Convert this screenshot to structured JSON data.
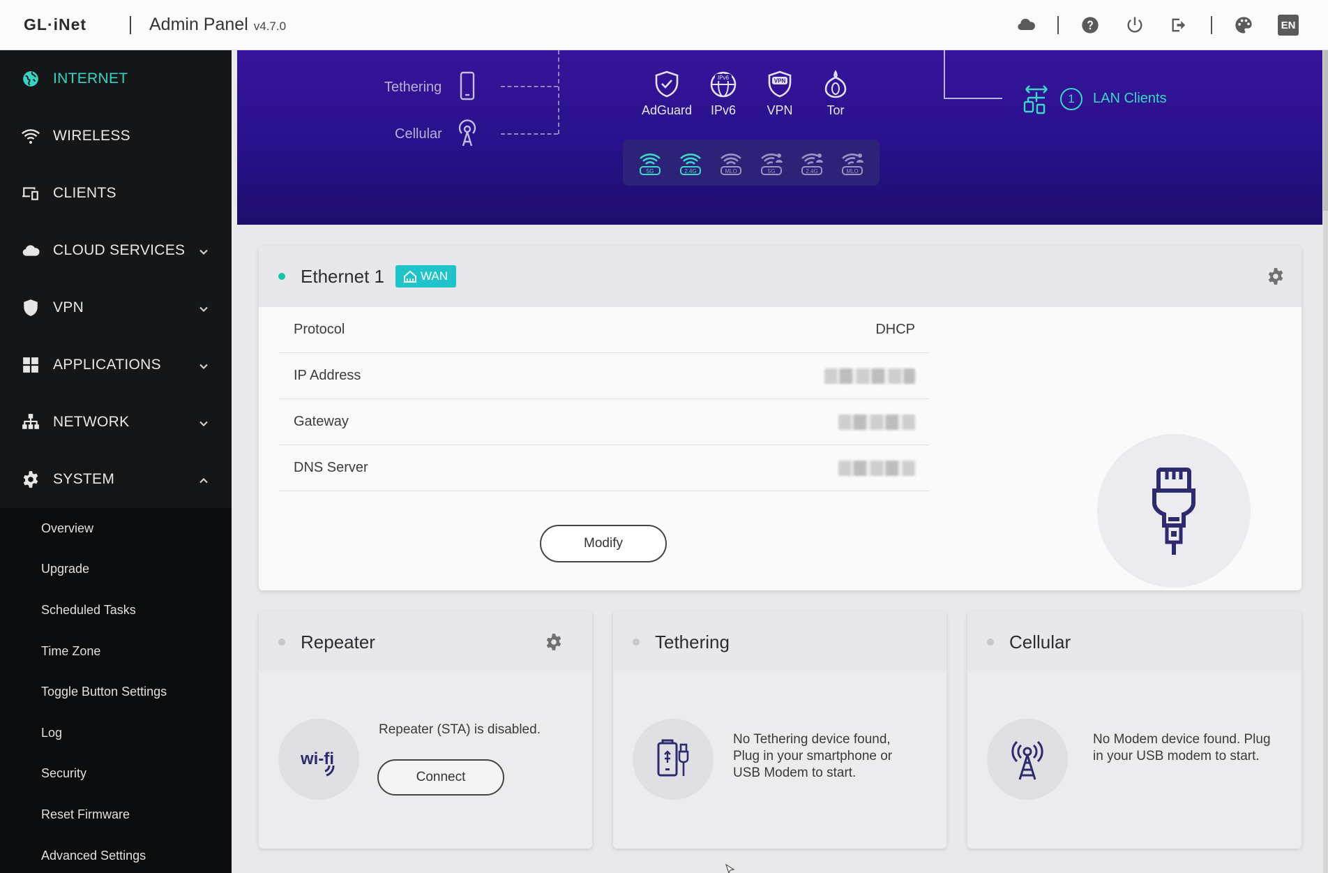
{
  "topbar": {
    "logo": "GL·iNet",
    "title": "Admin Panel",
    "version": "v4.7.0",
    "icons": [
      "cloud-icon",
      "help-icon",
      "power-icon",
      "logout-icon",
      "theme-icon"
    ],
    "language": "EN"
  },
  "sidebar": {
    "items": [
      {
        "label": "INTERNET",
        "icon": "globe-icon",
        "active": true
      },
      {
        "label": "WIRELESS",
        "icon": "wifi-icon"
      },
      {
        "label": "CLIENTS",
        "icon": "devices-icon"
      },
      {
        "label": "CLOUD SERVICES",
        "icon": "cloud-icon",
        "expandable": true
      },
      {
        "label": "VPN",
        "icon": "shield-icon",
        "expandable": true
      },
      {
        "label": "APPLICATIONS",
        "icon": "apps-icon",
        "expandable": true
      },
      {
        "label": "NETWORK",
        "icon": "network-icon",
        "expandable": true
      },
      {
        "label": "SYSTEM",
        "icon": "gear-icon",
        "expandable": true,
        "expanded": true
      }
    ],
    "system_submenu": [
      "Overview",
      "Upgrade",
      "Scheduled Tasks",
      "Time Zone",
      "Toggle Button Settings",
      "Log",
      "Security",
      "Reset Firmware",
      "Advanced Settings"
    ]
  },
  "topology": {
    "sources": [
      {
        "label": "Tethering",
        "icon": "phone-icon"
      },
      {
        "label": "Cellular",
        "icon": "antenna-icon"
      }
    ],
    "services": [
      "AdGuard",
      "IPv6",
      "VPN",
      "Tor"
    ],
    "wifi_bands": [
      "5G",
      "2.4G",
      "MLO",
      "5G",
      "2.4G",
      "MLO"
    ],
    "lan_clients_count": "1",
    "lan_clients_label": "LAN Clients"
  },
  "ethernet": {
    "title": "Ethernet 1",
    "badge": "WAN",
    "rows": [
      {
        "label": "Protocol",
        "value": "DHCP"
      },
      {
        "label": "IP Address",
        "value": ""
      },
      {
        "label": "Gateway",
        "value": ""
      },
      {
        "label": "DNS Server",
        "value": ""
      }
    ],
    "modify_label": "Modify"
  },
  "repeater": {
    "title": "Repeater",
    "message": "Repeater (STA) is disabled.",
    "connect_label": "Connect",
    "icon_text": "wi-fi"
  },
  "tethering": {
    "title": "Tethering",
    "message": "No Tethering device found, Plug in your smartphone or USB Modem to start."
  },
  "cellular": {
    "title": "Cellular",
    "message": "No Modem device found. Plug in your USB modem to start."
  },
  "colors": {
    "accent": "#37d4c4",
    "banner": "#28118a",
    "sidebar": "#141618",
    "wan_badge": "#1fc3c9"
  }
}
